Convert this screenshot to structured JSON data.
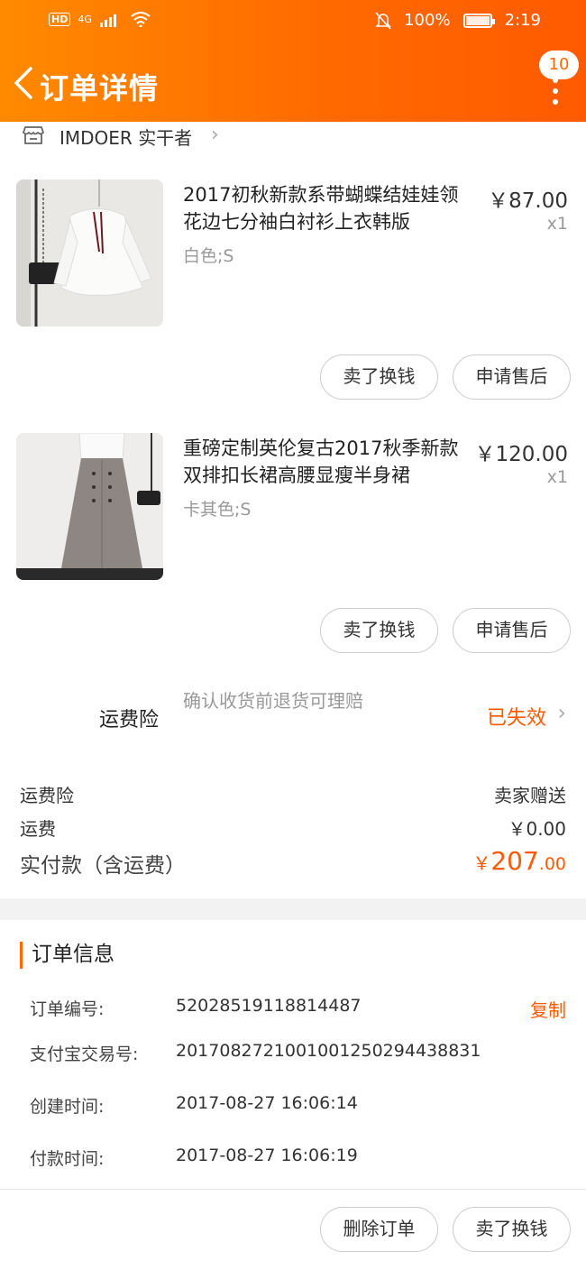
{
  "status_bar": {
    "network": "HD",
    "signal": "4G",
    "battery": "100%",
    "time": "2:19",
    "battery_level": 1.0
  },
  "header": {
    "title": "订单详情",
    "message_count": "10"
  },
  "shop": {
    "name": "IMDOER 实干者"
  },
  "items": [
    {
      "title": "2017初秋新款系带蝴蝶结娃娃领花边七分袖白衬衫上衣韩版",
      "sku": "白色;S",
      "price": "￥87.00",
      "qty": "x1",
      "btn_sell": "卖了换钱",
      "btn_after_sale": "申请售后"
    },
    {
      "title": "重磅定制英伦复古2017秋季新款双排扣长裙高腰显瘦半身裙",
      "sku": "卡其色;S",
      "price": "￥120.00",
      "qty": "x1",
      "btn_sell": "卖了换钱",
      "btn_after_sale": "申请售后"
    }
  ],
  "insurance": {
    "label": "运费险",
    "desc": "确认收货前退货可理赔",
    "status": "已失效"
  },
  "fees": {
    "insurance_label": "运费险",
    "insurance_value": "卖家赠送",
    "shipping_label": "运费",
    "shipping_value": "￥0.00",
    "total_label": "实付款（含运费）",
    "total_yen": "￥",
    "total_int": "207",
    "total_dec": ".00"
  },
  "order_info": {
    "title": "订单信息",
    "order_no_label": "订单编号:",
    "order_no": "52028519118814487",
    "copy": "复制",
    "alipay_label": "支付宝交易号:",
    "alipay_no": "2017082721001001250294438831",
    "created_label": "创建时间:",
    "created": "2017-08-27 16:06:14",
    "paid_label": "付款时间:",
    "paid": "2017-08-27 16:06:19"
  },
  "footer": {
    "delete": "删除订单",
    "sell": "卖了换钱"
  },
  "colors": {
    "accent": "#ff6a00",
    "price_accent": "#ff5a00"
  }
}
